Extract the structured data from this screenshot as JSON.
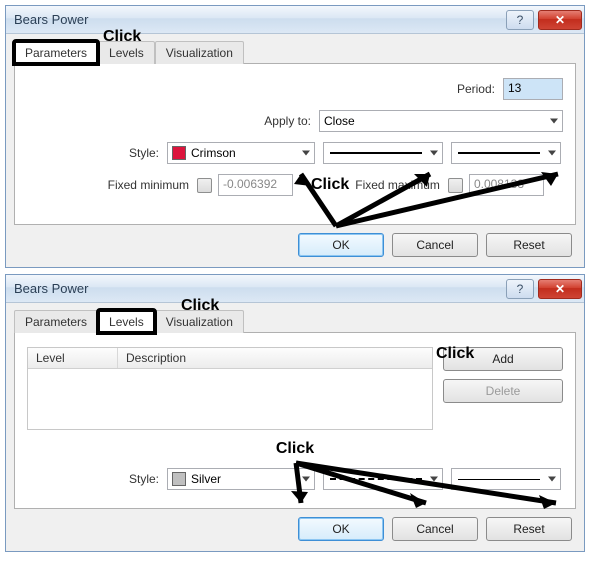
{
  "dialog1": {
    "title": "Bears Power",
    "tabs": {
      "parameters": "Parameters",
      "levels": "Levels",
      "visualization": "Visualization"
    },
    "labels": {
      "period": "Period:",
      "apply_to": "Apply to:",
      "style": "Style:",
      "fixed_min": "Fixed minimum",
      "fixed_max": "Fixed maximum"
    },
    "values": {
      "period": "13",
      "apply_to": "Close",
      "style_color": "Crimson",
      "style_swatch": "#dc143c",
      "fixed_min": "-0.006392",
      "fixed_max": "0.008133"
    },
    "buttons": {
      "ok": "OK",
      "cancel": "Cancel",
      "reset": "Reset"
    }
  },
  "dialog2": {
    "title": "Bears Power",
    "tabs": {
      "parameters": "Parameters",
      "levels": "Levels",
      "visualization": "Visualization"
    },
    "table": {
      "col_level": "Level",
      "col_desc": "Description"
    },
    "sidebtns": {
      "add": "Add",
      "delete": "Delete"
    },
    "labels": {
      "style": "Style:"
    },
    "values": {
      "style_color": "Silver",
      "style_swatch": "#c0c0c0"
    },
    "buttons": {
      "ok": "OK",
      "cancel": "Cancel",
      "reset": "Reset"
    }
  },
  "annotations": {
    "click": "Click"
  }
}
